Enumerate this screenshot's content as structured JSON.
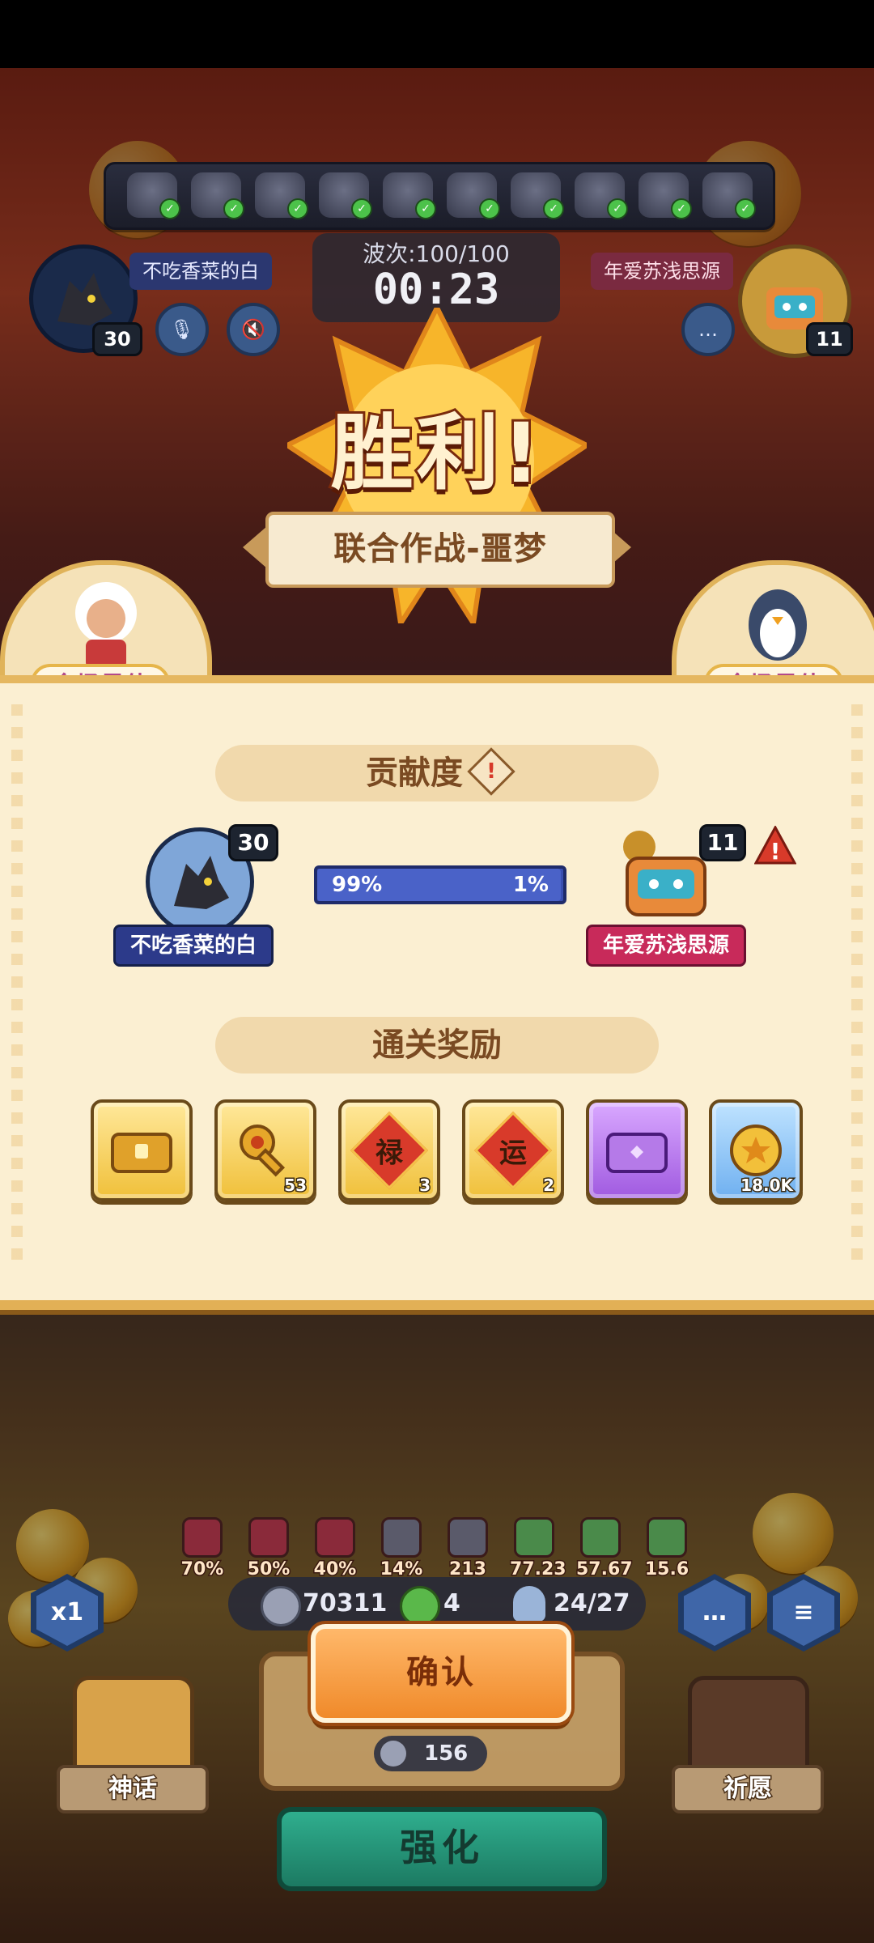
{
  "top_bar": {
    "heroes": [
      "hero-1",
      "hero-2",
      "hero-3",
      "hero-4",
      "hero-5",
      "hero-6",
      "hero-7",
      "hero-8",
      "hero-9",
      "hero-10"
    ]
  },
  "player_left": {
    "name": "不吃香菜的白",
    "level": "30"
  },
  "player_right": {
    "name": "年爱苏浅思源",
    "level": "11"
  },
  "wave": {
    "label": "波次:",
    "value": "100/100",
    "timer": "00:23"
  },
  "victory": {
    "title": "胜利!",
    "mode": "联合作战-噩梦"
  },
  "mvp": {
    "left_label": "全场最佳",
    "right_label": "全场最佳"
  },
  "contribution": {
    "title": "贡献度",
    "left_percent": "99%",
    "right_percent": "1%",
    "left_fraction": 0.99,
    "warn_icon": "!"
  },
  "rewards": {
    "title": "通关奖励",
    "items": [
      {
        "icon": "gold-chest-icon",
        "count": ""
      },
      {
        "icon": "key-icon",
        "count": "53"
      },
      {
        "icon": "lu-card-icon",
        "glyph": "禄",
        "count": "3"
      },
      {
        "icon": "yun-card-icon",
        "glyph": "运",
        "count": "2"
      },
      {
        "icon": "purple-chest-icon",
        "count": ""
      },
      {
        "icon": "gold-coin-icon",
        "count": "18.0K"
      }
    ]
  },
  "stats": [
    {
      "icon": "heart-icon",
      "value": "70%"
    },
    {
      "icon": "target-icon",
      "value": "50%"
    },
    {
      "icon": "skull-icon",
      "value": "40%"
    },
    {
      "icon": "broken-heart-icon",
      "value": "14%"
    },
    {
      "icon": "burst-icon",
      "value": "213"
    },
    {
      "icon": "fist-icon",
      "value": "77.23"
    },
    {
      "icon": "arrow-up-icon",
      "value": "57.67"
    },
    {
      "icon": "timer-icon",
      "value": "15.6"
    }
  ],
  "resources": {
    "silver": "70311",
    "clover": "4",
    "units": "24/27"
  },
  "buttons": {
    "speed": "x1",
    "confirm": "确认",
    "strengthen": "强化",
    "cost": "156",
    "myth": "神话",
    "wish": "祈愿"
  },
  "colors": {
    "panel": "#fbefd2",
    "accent": "#e5b760",
    "confirm": "#f08a2a",
    "strengthen": "#1c7a62"
  }
}
